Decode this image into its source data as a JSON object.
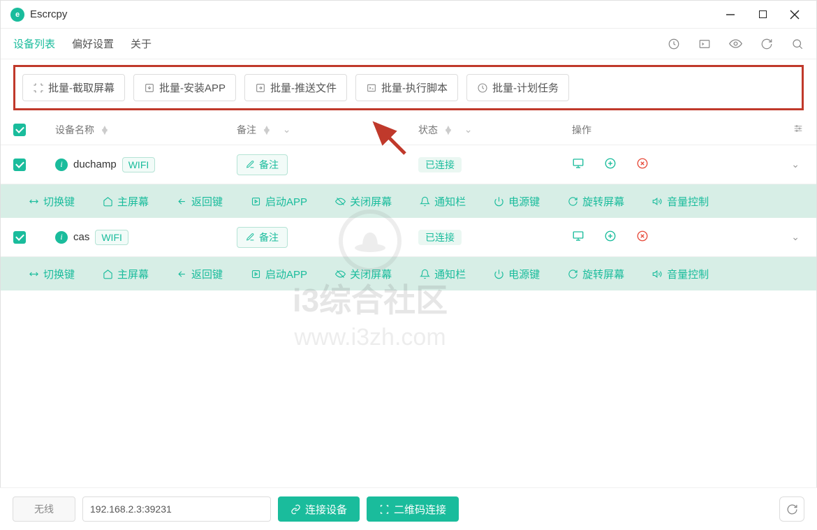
{
  "app": {
    "title": "Escrcpy"
  },
  "tabs": {
    "device_list": "设备列表",
    "preferences": "偏好设置",
    "about": "关于"
  },
  "batch": {
    "screenshot": "批量-截取屏幕",
    "install": "批量-安装APP",
    "push": "批量-推送文件",
    "script": "批量-执行脚本",
    "schedule": "批量-计划任务"
  },
  "headers": {
    "name": "设备名称",
    "remark": "备注",
    "status": "状态",
    "operate": "操作"
  },
  "devices": [
    {
      "name": "duchamp",
      "conn": "WIFI",
      "remark_btn": "备注",
      "status": "已连接"
    },
    {
      "name": "cas",
      "conn": "WIFI",
      "remark_btn": "备注",
      "status": "已连接"
    }
  ],
  "actions": {
    "switch_key": "切换键",
    "home": "主屏幕",
    "back": "返回键",
    "launch_app": "启动APP",
    "close_screen": "关闭屏幕",
    "notification": "通知栏",
    "power": "电源键",
    "rotate": "旋转屏幕",
    "volume": "音量控制"
  },
  "footer": {
    "mode": "无线",
    "addr": "192.168.2.3:39231",
    "connect": "连接设备",
    "qr": "二维码连接"
  },
  "watermark": {
    "cn": "i3综合社区",
    "url": "www.i3zh.com"
  }
}
